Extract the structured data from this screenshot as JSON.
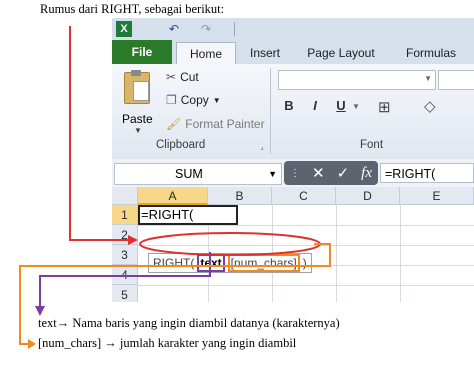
{
  "caption_top": "Rumus dari RIGHT, sebagai berikut:",
  "excel": {
    "qat_icons": [
      "excel-logo-icon",
      "undo-icon",
      "redo-icon"
    ],
    "tabs": [
      "File",
      "Home",
      "Insert",
      "Page Layout",
      "Formulas"
    ],
    "ribbon": {
      "paste_label": "Paste",
      "cut_label": "Cut",
      "copy_label": "Copy",
      "format_painter_label": "Format Painter",
      "clipboard_group": "Clipboard",
      "font_group": "Font",
      "bold": "B",
      "italic": "I",
      "underline": "U"
    },
    "formula_bar": {
      "name_box": "SUM",
      "cancel_symbol": "✕",
      "enter_symbol": "✓",
      "fx_symbol": "fx",
      "formula": "=RIGHT("
    },
    "columns": [
      "A",
      "B",
      "C",
      "D",
      "E"
    ],
    "rows": [
      "1",
      "2",
      "3",
      "4",
      "5"
    ],
    "cell_a1": "=RIGHT(",
    "tooltip": {
      "func": "RIGHT(",
      "arg1": "text",
      "arg2": "[num_chars]",
      "close": ")"
    }
  },
  "notes": {
    "text_arg": "text",
    "text_desc": " Nama baris yang ingin diambil datanya (karakternya)",
    "num_arg": "[num_chars]",
    "num_desc": " jumlah karakter yang ingin diambil",
    "arrow_glyph": "→"
  },
  "colors": {
    "red_arrow": "#e03030",
    "purple_arrow": "#7a3fa0",
    "orange_arrow": "#f08a20",
    "file_tab": "#2a7a2a"
  }
}
